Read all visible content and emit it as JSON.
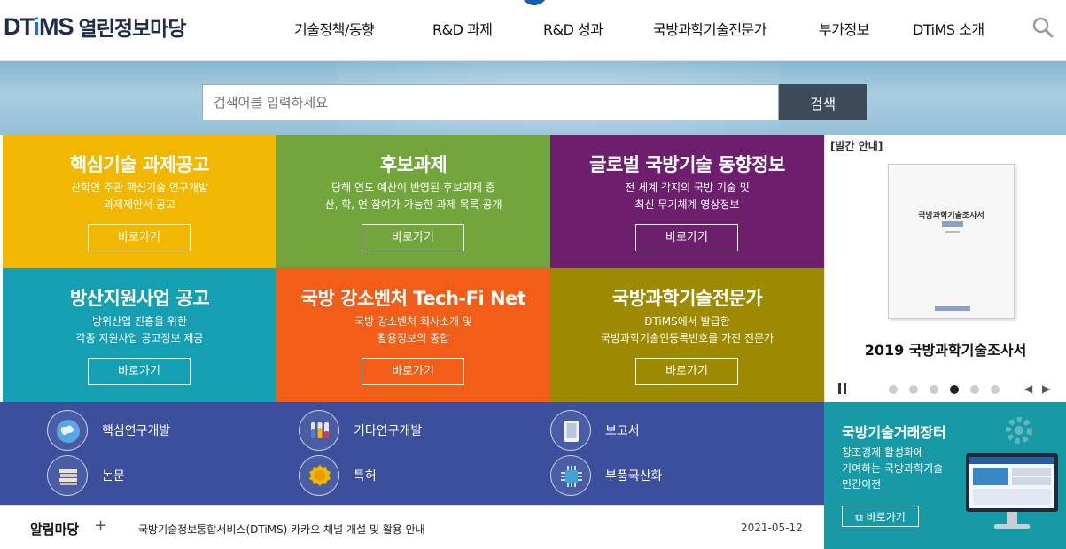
{
  "header": {
    "logo_mark_a": "DT",
    "logo_mark_i": "i",
    "logo_mark_b": "MS",
    "logo_sub": "열린정보마당",
    "nav": [
      "기술정책/동향",
      "R&D 과제",
      "R&D 성과",
      "국방과학기술전문가",
      "부가정보",
      "DTiMS 소개"
    ],
    "search_icon": "search-icon"
  },
  "search": {
    "placeholder": "검색어를 입력하세요",
    "button": "검색"
  },
  "tiles": [
    {
      "title": "핵심기술 과제공고",
      "desc": [
        "산학연 주관 핵심기술 연구개발",
        "과제제안서 공고"
      ],
      "button": "바로가기",
      "color": "#f2b700"
    },
    {
      "title": "후보과제",
      "desc": [
        "당해 연도 예산이 반영된 후보과제 중",
        "산, 학, 연 참여가 가능한 과제 목록 공개"
      ],
      "button": "바로가기",
      "color": "#72a63c"
    },
    {
      "title": "글로벌 국방기술 동향정보",
      "desc": [
        "전 세계 각지의 국방 기술 및",
        "최신 무기체계 영상정보"
      ],
      "button": "바로가기",
      "color": "#6d1f6e"
    },
    {
      "title": "방산지원사업 공고",
      "desc": [
        "방위산업 진흥을 위한",
        "각종 지원사업 공고정보 제공"
      ],
      "button": "바로가기",
      "color": "#149fb2"
    },
    {
      "title": "국방 강소벤처 Tech-Fi Net",
      "desc": [
        "국방 강소벤처 회사소개 및",
        "활용정보의 종합"
      ],
      "button": "바로가기",
      "color": "#f25d17"
    },
    {
      "title": "국방과학기술전문가",
      "desc": [
        "DTiMS에서 발급한",
        "국방과학기술인등록번호를 가진 전문가"
      ],
      "button": "바로가기",
      "color": "#9d8a00"
    }
  ],
  "publication": {
    "tag": "[발간 안내]",
    "book_title": "국방과학기술조사서",
    "title": "2019 국방과학기술조사서",
    "dots": 6,
    "active_dot": 4
  },
  "links": [
    {
      "label": "핵심연구개발",
      "icon": "globe-icon"
    },
    {
      "label": "기타연구개발",
      "icon": "test-tubes-icon"
    },
    {
      "label": "보고서",
      "icon": "tablet-icon"
    },
    {
      "label": "논문",
      "icon": "books-icon"
    },
    {
      "label": "특허",
      "icon": "medal-icon"
    },
    {
      "label": "부품국산화",
      "icon": "chip-icon"
    }
  ],
  "market": {
    "title": "국방기술거래장터",
    "desc": [
      "창조경제 활성화에",
      "기여하는 국방과학기술",
      "민간이전"
    ],
    "button": "바로가기"
  },
  "notice": {
    "label": "알림마당",
    "plus": "+",
    "text": "국방기술정보통합서비스(DTiMS) 카카오 채널 개설 및 활용 안내",
    "date": "2021-05-12"
  },
  "colors": {
    "links_band": "#3b4f9c",
    "market": "#179aa5",
    "search_button": "#3d4a5a"
  }
}
